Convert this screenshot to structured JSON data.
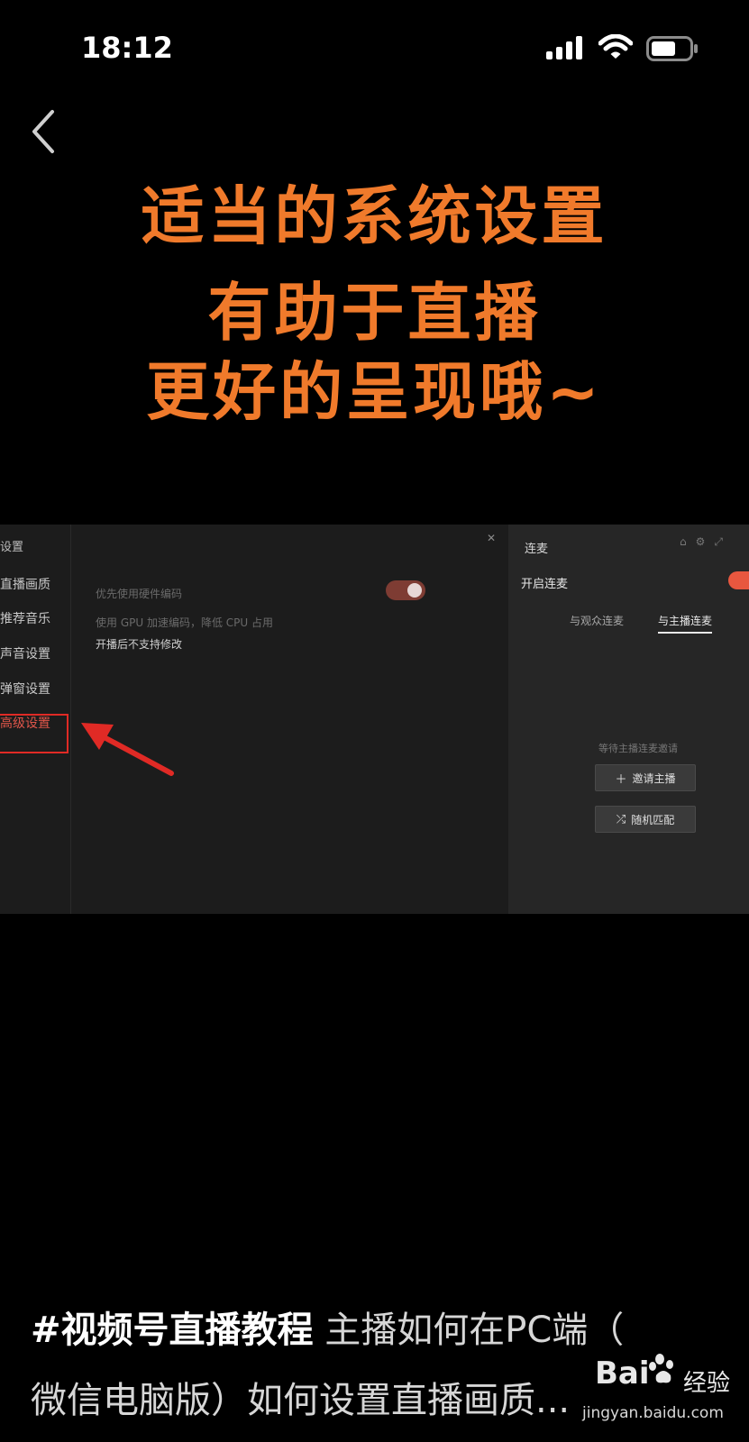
{
  "status_bar": {
    "time": "18:12",
    "icons": [
      "signal-icon",
      "wifi-icon",
      "battery-icon"
    ]
  },
  "nav": {
    "back_icon": "back-chevron-icon"
  },
  "video": {
    "headline": [
      "适当的系统设置",
      "有助于直播",
      "更好的呈现哦~"
    ],
    "headline_color": "#f07a2b",
    "screen": {
      "settings": {
        "title": "设置",
        "close_icon": "close-icon",
        "sidebar_items": [
          "直播画质",
          "推荐音乐",
          "声音设置",
          "弹窗设置",
          "高级设置"
        ],
        "active_item_index": 4,
        "highlight_color": "#e02a25",
        "option_label": "优先使用硬件编码",
        "option_desc": "使用 GPU 加速编码，降低 CPU 占用",
        "option_note": "开播后不支持修改",
        "option_enabled": true
      },
      "lianmai": {
        "title": "连麦",
        "header_icons": [
          "home-icon",
          "settings-icon",
          "popout-icon"
        ],
        "open_label": "开启连麦",
        "open_enabled": true,
        "tabs": [
          "与观众连麦",
          "与主播连麦"
        ],
        "active_tab_index": 1,
        "waiting_text": "等待主播连麦邀请",
        "invite_button": "邀请主播",
        "match_button": "随机匹配"
      }
    }
  },
  "caption": {
    "hashtag": "#视频号直播教程",
    "title_line1": "主播如何在PC端（",
    "title_line2": "微信电脑版）如何设置直播画质..."
  },
  "watermark": {
    "brand": "Bai",
    "suffix": "经验",
    "url": "jingyan.baidu.com"
  }
}
